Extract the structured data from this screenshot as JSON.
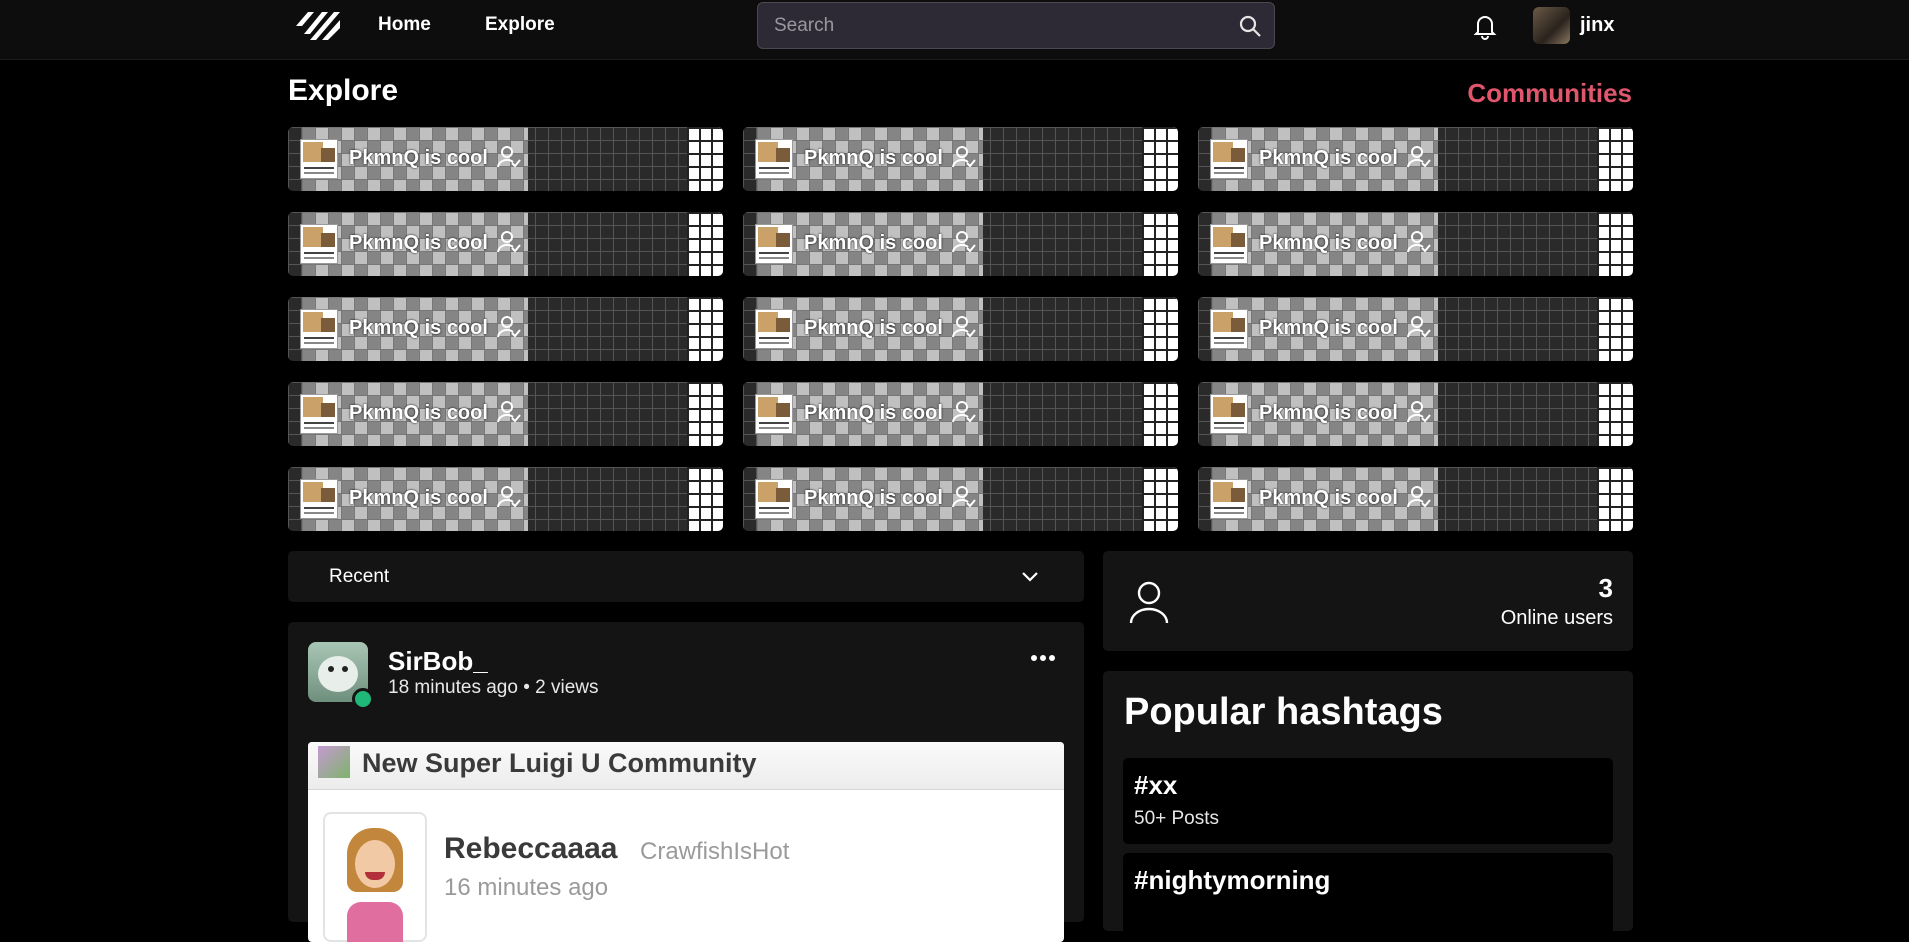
{
  "nav": {
    "home_label": "Home",
    "explore_label": "Explore",
    "search_placeholder": "Search",
    "user_name": "jinx"
  },
  "explore": {
    "title": "Explore",
    "communities_link": "Communities",
    "community_name": "PkmnQ is cool",
    "community_count": 15
  },
  "feed": {
    "sort_label": "Recent",
    "post": {
      "author": "SirBob_",
      "meta": "18 minutes ago • 2 views",
      "screenshot": {
        "title": "New Super Luigi U Community",
        "user": "Rebeccaaaa",
        "handle": "CrawfishIsHot",
        "time": "16 minutes ago"
      }
    }
  },
  "sidebar": {
    "online_count": "3",
    "online_label": "Online users",
    "hashtags_title": "Popular hashtags",
    "hashtags": [
      {
        "name": "#xx",
        "count": "50+ Posts"
      },
      {
        "name": "#nightymorning",
        "count": ""
      }
    ]
  },
  "colors": {
    "accent": "#e0566c",
    "online": "#1fb878",
    "panel": "#141414"
  },
  "icons": [
    "logo-icon",
    "search-icon",
    "bell-icon",
    "person-check-icon",
    "chevron-down-icon",
    "more-icon",
    "person-icon"
  ]
}
